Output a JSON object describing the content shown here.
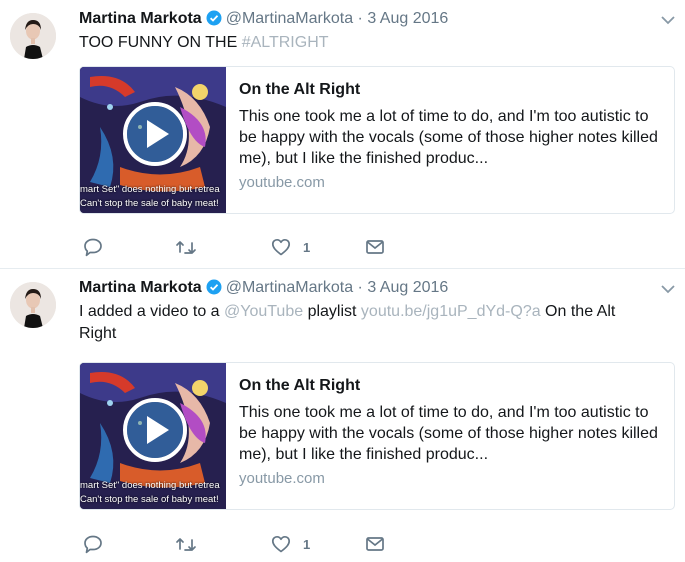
{
  "tweets": [
    {
      "name": "Martina Markota",
      "handle": "@MartinaMarkota",
      "separator": "·",
      "date": "3 Aug 2016",
      "text_main": "TOO FUNNY ON THE ",
      "text_hashtag": "#ALTRIGHT",
      "card": {
        "title": "On the Alt Right",
        "description": "This one took me a lot of time to do, and I'm too autistic to be happy with the vocals (some of those higher notes killed me), but I like the finished produc...",
        "url": "youtube.com",
        "caption_line1": "mart Set\" does nothing but retrea",
        "caption_line2": "Can't stop the sale of baby meat!"
      },
      "like_count": "1"
    },
    {
      "name": "Martina Markota",
      "handle": "@MartinaMarkota",
      "separator": "·",
      "date": "3 Aug 2016",
      "text_a": "I added a video to a ",
      "text_mention": "@YouTube",
      "text_b": " playlist ",
      "text_link": "youtu.be/jg1uP_dYd-Q?a",
      "text_c": " On the Alt Right",
      "card": {
        "title": "On the Alt Right",
        "description": "This one took me a lot of time to do, and I'm too autistic to be happy with the vocals (some of those higher notes killed me), but I like the finished produc...",
        "url": "youtube.com",
        "caption_line1": "mart Set\" does nothing but retrea",
        "caption_line2": "Can't stop the sale of baby meat!"
      },
      "like_count": "1"
    }
  ],
  "icons": [
    "verified-icon",
    "chevron-down-icon",
    "reply-icon",
    "retweet-icon",
    "like-icon",
    "message-icon",
    "play-icon"
  ],
  "colors": {
    "verified": "#1da1f2",
    "muted": "#a9b4bd",
    "icon": "#657786",
    "border": "#e6ecf0"
  }
}
